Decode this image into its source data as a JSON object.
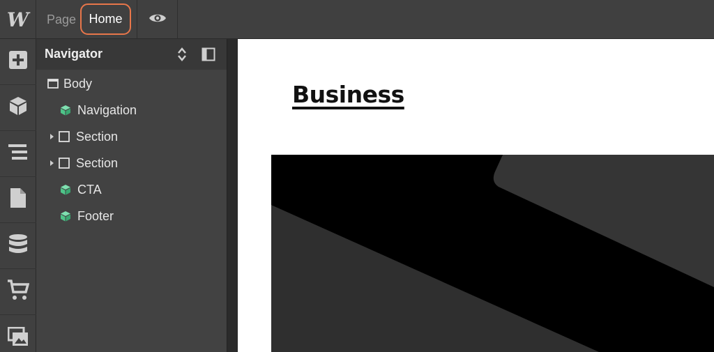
{
  "app": {
    "logo_letter": "W"
  },
  "topbar": {
    "page_label": "Page",
    "current_page": "Home"
  },
  "rail": {
    "icons": [
      "add-icon",
      "cube-icon",
      "navigator-icon",
      "pages-icon",
      "cms-database-icon",
      "ecommerce-cart-icon",
      "assets-icon"
    ]
  },
  "navigator": {
    "title": "Navigator",
    "items": [
      {
        "label": "Body",
        "icon": "body-window-icon",
        "expandable": false
      },
      {
        "label": "Navigation",
        "icon": "symbol-cube-icon",
        "expandable": false
      },
      {
        "label": "Section",
        "icon": "section-box-icon",
        "expandable": true
      },
      {
        "label": "Section",
        "icon": "section-box-icon",
        "expandable": true
      },
      {
        "label": "CTA",
        "icon": "symbol-cube-icon",
        "expandable": false
      },
      {
        "label": "Footer",
        "icon": "symbol-cube-icon",
        "expandable": false
      }
    ]
  },
  "canvas": {
    "heading": "Business"
  },
  "colors": {
    "highlight": "#e8764a",
    "symbol_green": "#5bd39a",
    "panel_bg": "#424242",
    "bar_bg": "#404040"
  }
}
